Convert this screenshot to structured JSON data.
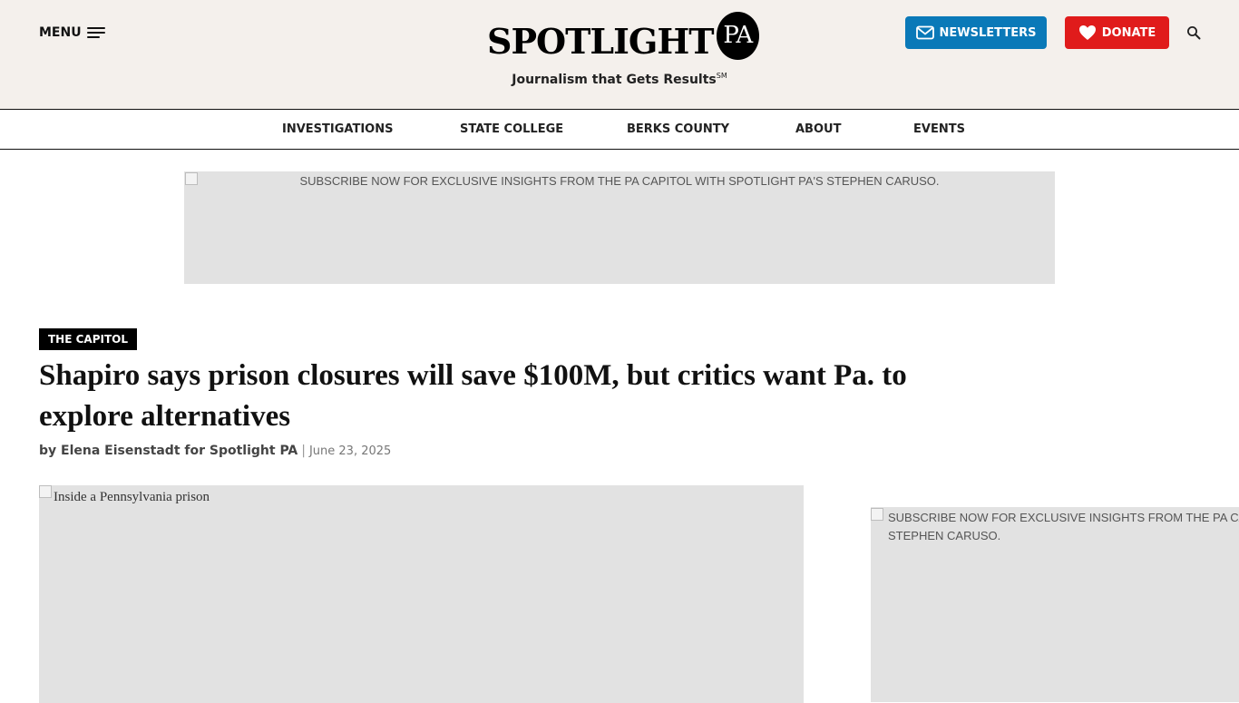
{
  "header": {
    "menu_label": "MENU",
    "logo_word": "SPOTLIGHT",
    "logo_badge": "PA",
    "tagline": "Journalism that Gets Results",
    "tagline_mark": "SM",
    "newsletters_label": "NEWSLETTERS",
    "donate_label": "DONATE",
    "colors": {
      "background": "#f4f0ec",
      "newsletters": "#0a79b8",
      "donate": "#e01b1b"
    }
  },
  "nav": {
    "items": [
      {
        "label": "INVESTIGATIONS"
      },
      {
        "label": "STATE COLLEGE"
      },
      {
        "label": "BERKS COUNTY"
      },
      {
        "label": "ABOUT"
      },
      {
        "label": "EVENTS"
      }
    ]
  },
  "ad_banner": {
    "alt_text": "SUBSCRIBE NOW FOR EXCLUSIVE INSIGHTS FROM THE PA CAPITOL WITH SPOTLIGHT PA'S STEPHEN CARUSO."
  },
  "article": {
    "kicker": "THE CAPITOL",
    "headline": "Shapiro says prison closures will save $100M, but critics want Pa. to explore alternatives",
    "byline_author": "by Elena Eisenstadt for Spotlight PA",
    "byline_separator": "|",
    "date": "June 23, 2025",
    "hero_image_alt": "Inside a Pennsylvania prison"
  },
  "side_ad": {
    "alt_text": "SUBSCRIBE NOW FOR EXCLUSIVE INSIGHTS FROM THE PA CAPITOL WITH SPOTLIGHT PA'S STEPHEN CARUSO."
  }
}
